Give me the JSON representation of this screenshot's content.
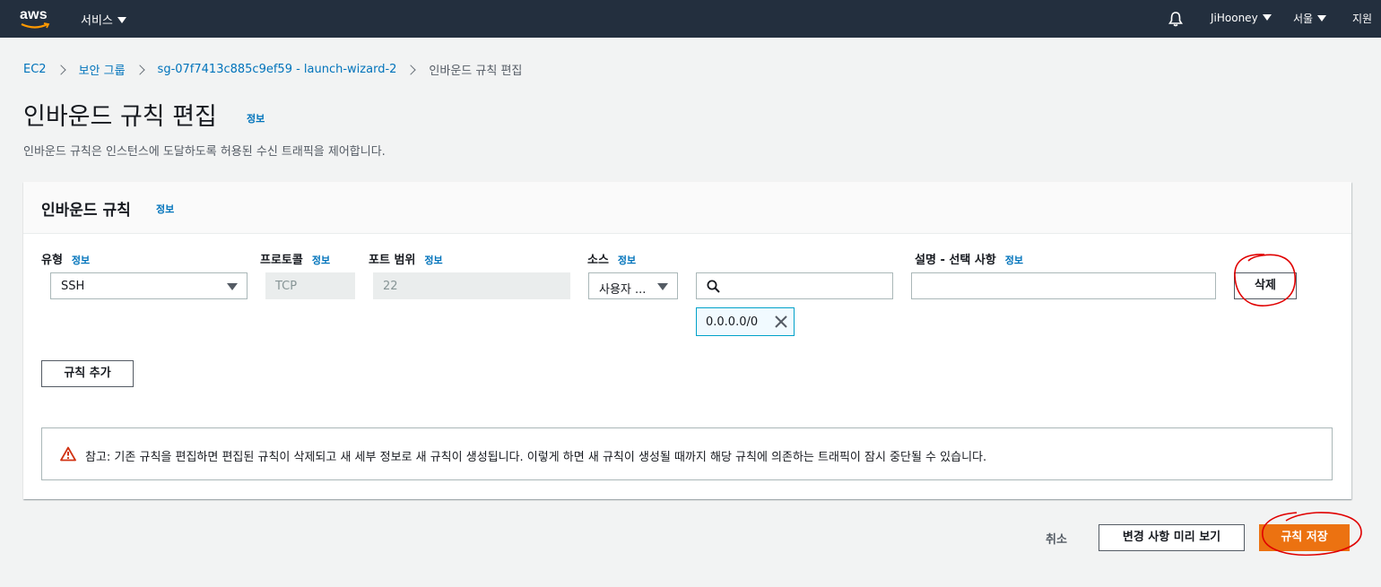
{
  "topnav": {
    "logo_text": "aws",
    "services_label": "서비스",
    "user_label": "JiHooney",
    "region_label": "서울",
    "support_label": "지원"
  },
  "breadcrumb": {
    "items": [
      "EC2",
      "보안 그룹",
      "sg-07f7413c885c9ef59 - launch-wizard-2"
    ],
    "current": "인바운드 규칙 편집"
  },
  "page": {
    "title": "인바운드 규칙 편집",
    "title_info": "정보",
    "description": "인바운드 규칙은 인스턴스에 도달하도록 허용된 수신 트래픽을 제어합니다."
  },
  "panel": {
    "title": "인바운드 규칙",
    "info": "정보",
    "columns": {
      "type": "유형",
      "protocol": "프로토콜",
      "port_range": "포트 범위",
      "source": "소스",
      "description": "설명 - 선택 사항",
      "info": "정보"
    },
    "rule": {
      "type_value": "SSH",
      "protocol_value": "TCP",
      "port_value": "22",
      "source_type_value": "사용자 ...",
      "source_search_value": "",
      "cidr_token": "0.0.0.0/0",
      "description_value": "",
      "delete_label": "삭제"
    },
    "add_rule_label": "규칙 추가",
    "alert_text": "참고: 기존 규칙을 편집하면 편집된 규칙이 삭제되고 새 세부 정보로 새 규칙이 생성됩니다. 이렇게 하면 새 규칙이 생성될 때까지 해당 규칙에 의존하는 트래픽이 잠시 중단될 수 있습니다."
  },
  "footer": {
    "cancel_label": "취소",
    "preview_label": "변경 사항 미리 보기",
    "save_label": "규칙 저장"
  },
  "colors": {
    "nav_bg": "#232f3e",
    "link": "#0073bb",
    "primary": "#ec7211",
    "annotation": "#e00000"
  }
}
